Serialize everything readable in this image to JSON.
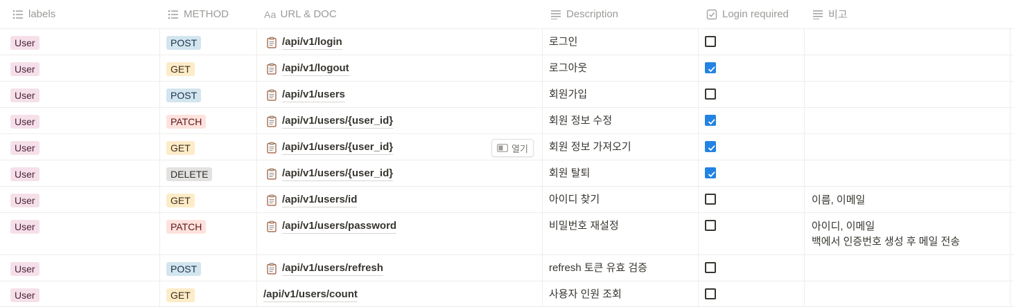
{
  "headers": {
    "labels": "labels",
    "method": "METHOD",
    "url_prefix": "Aa",
    "url": "URL & DOC",
    "description": "Description",
    "login": "Login required",
    "note": "비고"
  },
  "open_button": "열기",
  "colors": {
    "checkbox_checked": "#2383e2",
    "tag_user": "#f5e0e9",
    "tag_post": "#d3e5ef",
    "tag_get": "#fdecc8",
    "tag_patch": "#ffe2dd",
    "tag_delete": "#e3e2e0"
  },
  "rows": [
    {
      "label": "User",
      "method": "POST",
      "url": "/api/v1/login",
      "description": "로그인",
      "login_required": false,
      "note": ""
    },
    {
      "label": "User",
      "method": "GET",
      "url": "/api/v1/logout",
      "description": "로그아웃",
      "login_required": true,
      "note": ""
    },
    {
      "label": "User",
      "method": "POST",
      "url": "/api/v1/users",
      "description": "회원가입",
      "login_required": false,
      "note": ""
    },
    {
      "label": "User",
      "method": "PATCH",
      "url": "/api/v1/users/{user_id}",
      "description": "회원 정보 수정",
      "login_required": true,
      "note": ""
    },
    {
      "label": "User",
      "method": "GET",
      "url": "/api/v1/users/{user_id}",
      "description": "회원 정보 가져오기",
      "login_required": true,
      "note": ""
    },
    {
      "label": "User",
      "method": "DELETE",
      "url": "/api/v1/users/{user_id}",
      "description": "회원 탈퇴",
      "login_required": true,
      "note": ""
    },
    {
      "label": "User",
      "method": "GET",
      "url": "/api/v1/users/id",
      "description": "아이디 찾기",
      "login_required": false,
      "note": "이름, 이메일"
    },
    {
      "label": "User",
      "method": "PATCH",
      "url": "/api/v1/users/password",
      "description": "비밀번호 재설정",
      "login_required": false,
      "note_lines": [
        "아이디, 이메일",
        "백에서 인증번호 생성 후 메일 전송"
      ]
    },
    {
      "label": "User",
      "method": "POST",
      "url": "/api/v1/users/refresh",
      "description": "refresh 토큰 유효 검증",
      "login_required": false,
      "note": ""
    },
    {
      "label": "User",
      "method": "GET",
      "url": "/api/v1/users/count",
      "description": "사용자 인원 조회",
      "login_required": false,
      "note": ""
    }
  ]
}
